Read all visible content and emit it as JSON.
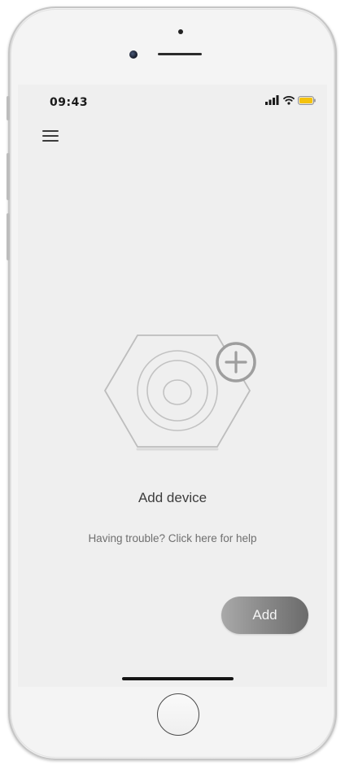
{
  "status_bar": {
    "time": "09:43",
    "battery_color": "#f4c20d"
  },
  "header": {
    "menu_icon": "hamburger-menu-icon"
  },
  "empty_state": {
    "illustration_icon": "hex-device-add-icon",
    "title": "Add device",
    "help_text": "Having trouble? Click here for help"
  },
  "actions": {
    "add_label": "Add"
  },
  "colors": {
    "screen_bg": "#efefef",
    "illustration_stroke": "#bdbdbd",
    "plus_badge_stroke": "#9e9e9e",
    "button_gradient_start": "#a9a9a9",
    "button_gradient_end": "#6b6b6b"
  }
}
